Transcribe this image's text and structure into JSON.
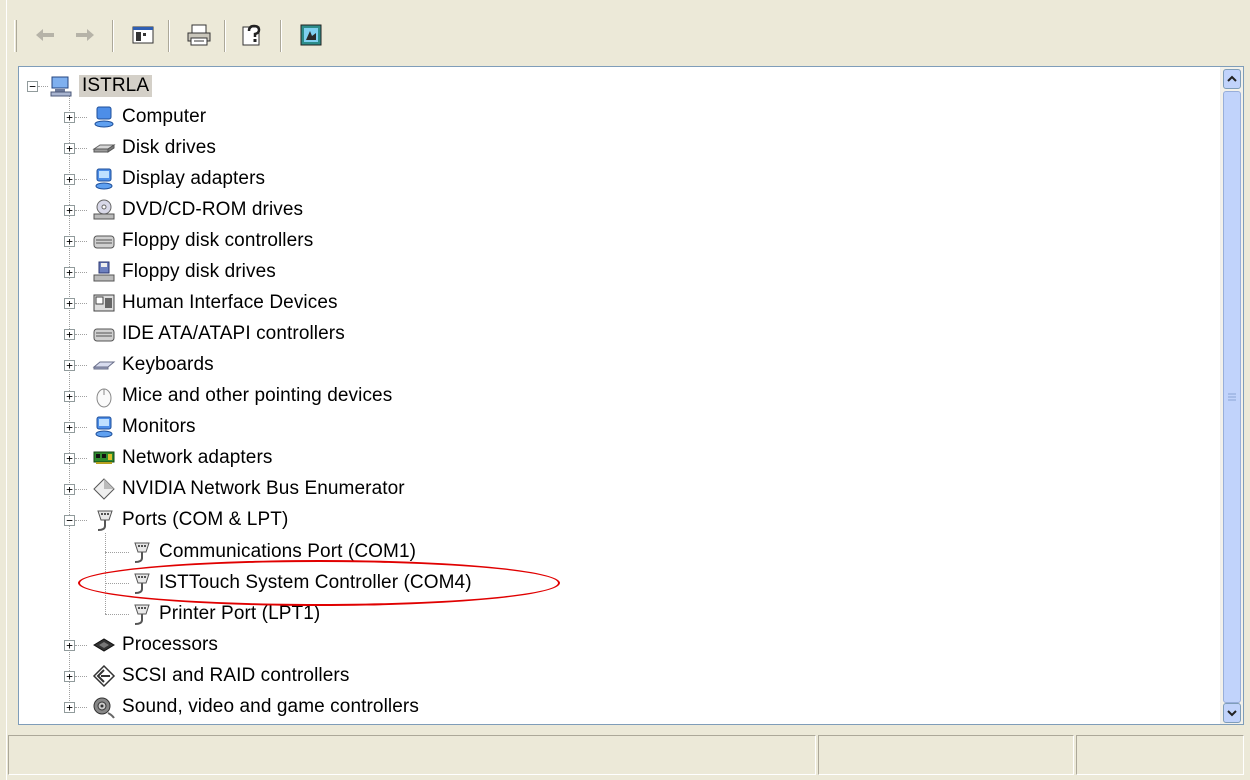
{
  "toolbar": {
    "buttons": [
      {
        "name": "back",
        "icon": "back-arrow-icon"
      },
      {
        "name": "forward",
        "icon": "forward-arrow-icon"
      },
      {
        "name": "show-hide-console-tree",
        "icon": "console-tree-icon"
      },
      {
        "name": "print",
        "icon": "printer-icon"
      },
      {
        "name": "help",
        "icon": "help-icon"
      },
      {
        "name": "properties",
        "icon": "properties-icon"
      }
    ]
  },
  "tree": {
    "root": {
      "label": "ISTRLA",
      "icon": "computer-icon",
      "expanded": true
    },
    "categories": [
      {
        "label": "Computer",
        "icon": "computer-icon"
      },
      {
        "label": "Disk drives",
        "icon": "disk-drive-icon"
      },
      {
        "label": "Display adapters",
        "icon": "display-adapter-icon"
      },
      {
        "label": "DVD/CD-ROM drives",
        "icon": "cdrom-icon"
      },
      {
        "label": "Floppy disk controllers",
        "icon": "controller-icon"
      },
      {
        "label": "Floppy disk drives",
        "icon": "floppy-icon"
      },
      {
        "label": "Human Interface Devices",
        "icon": "hid-icon"
      },
      {
        "label": "IDE ATA/ATAPI controllers",
        "icon": "controller-icon"
      },
      {
        "label": "Keyboards",
        "icon": "keyboard-icon"
      },
      {
        "label": "Mice and other pointing devices",
        "icon": "mouse-icon"
      },
      {
        "label": "Monitors",
        "icon": "monitor-icon"
      },
      {
        "label": "Network adapters",
        "icon": "network-adapter-icon"
      },
      {
        "label": "NVIDIA Network Bus Enumerator",
        "icon": "bus-enumerator-icon"
      },
      {
        "label": "Ports (COM & LPT)",
        "icon": "port-icon",
        "expanded": true,
        "children": [
          {
            "label": "Communications Port (COM1)",
            "icon": "port-icon"
          },
          {
            "label": "ISTTouch System Controller (COM4)",
            "icon": "port-icon",
            "highlighted": true
          },
          {
            "label": "Printer Port (LPT1)",
            "icon": "port-icon"
          }
        ]
      },
      {
        "label": "Processors",
        "icon": "processor-icon"
      },
      {
        "label": "SCSI and RAID controllers",
        "icon": "scsi-icon"
      },
      {
        "label": "Sound, video and game controllers",
        "icon": "sound-icon"
      }
    ]
  },
  "colors": {
    "highlight_ellipse": "#e00000",
    "window_bg": "#ece9d8"
  }
}
